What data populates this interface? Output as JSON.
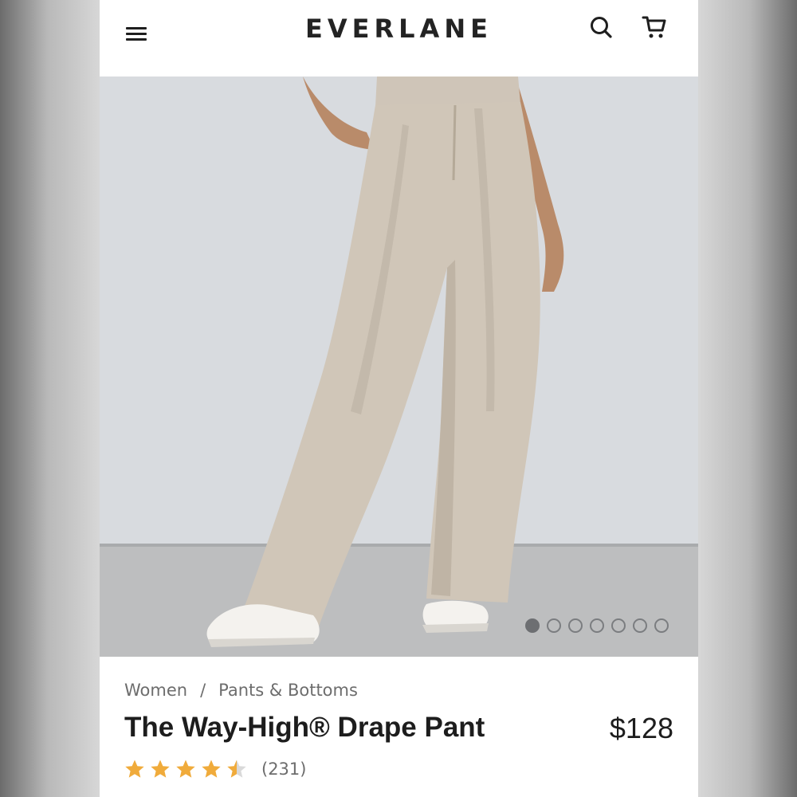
{
  "header": {
    "logo": "EVERLANE",
    "menu_icon": "hamburger-menu-icon",
    "search_icon": "search-icon",
    "cart_icon": "cart-icon"
  },
  "gallery": {
    "image_alt": "Woman wearing light beige wide-leg pleated pants and white sneakers",
    "total_images": 7,
    "active_index": 0
  },
  "product": {
    "breadcrumb": [
      "Women",
      "Pants & Bottoms"
    ],
    "breadcrumb_separator": "/",
    "title": "The Way-High® Drape Pant",
    "price": "$128",
    "rating_value": 4.5,
    "rating_max": 5,
    "review_count": "(231)"
  },
  "colors": {
    "star_filled": "#f0ab3b",
    "star_empty": "#d9d9d9",
    "text_primary": "#1d1d1d",
    "text_secondary": "#6d6d6d"
  }
}
